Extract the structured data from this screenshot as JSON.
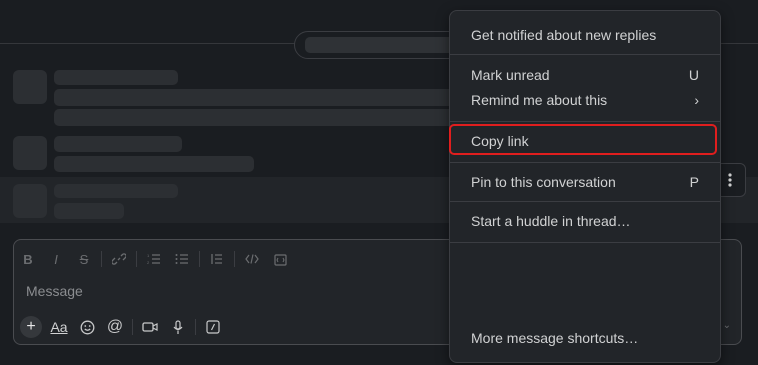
{
  "composer": {
    "placeholder": "Message",
    "format_icons": [
      "bold-icon",
      "italic-icon",
      "strikethrough-icon",
      "link-icon",
      "ordered-list-icon",
      "bulleted-list-icon",
      "blockquote-icon",
      "code-icon",
      "code-block-icon"
    ],
    "aa_label": "Aa"
  },
  "menu": {
    "items": [
      {
        "label": "Get notified about new replies",
        "shortcut": ""
      },
      {
        "label": "Mark unread",
        "shortcut": "U"
      },
      {
        "label": "Remind me about this",
        "shortcut": "›"
      },
      {
        "label": "Copy link",
        "shortcut": ""
      },
      {
        "label": "Pin to this conversation",
        "shortcut": "P"
      },
      {
        "label": "Start a huddle in thread…",
        "shortcut": ""
      },
      {
        "label": "More message shortcuts…",
        "shortcut": ""
      }
    ]
  },
  "colors": {
    "highlight": "#e01e1e",
    "background": "#1a1d21",
    "menu_bg": "#222529"
  }
}
